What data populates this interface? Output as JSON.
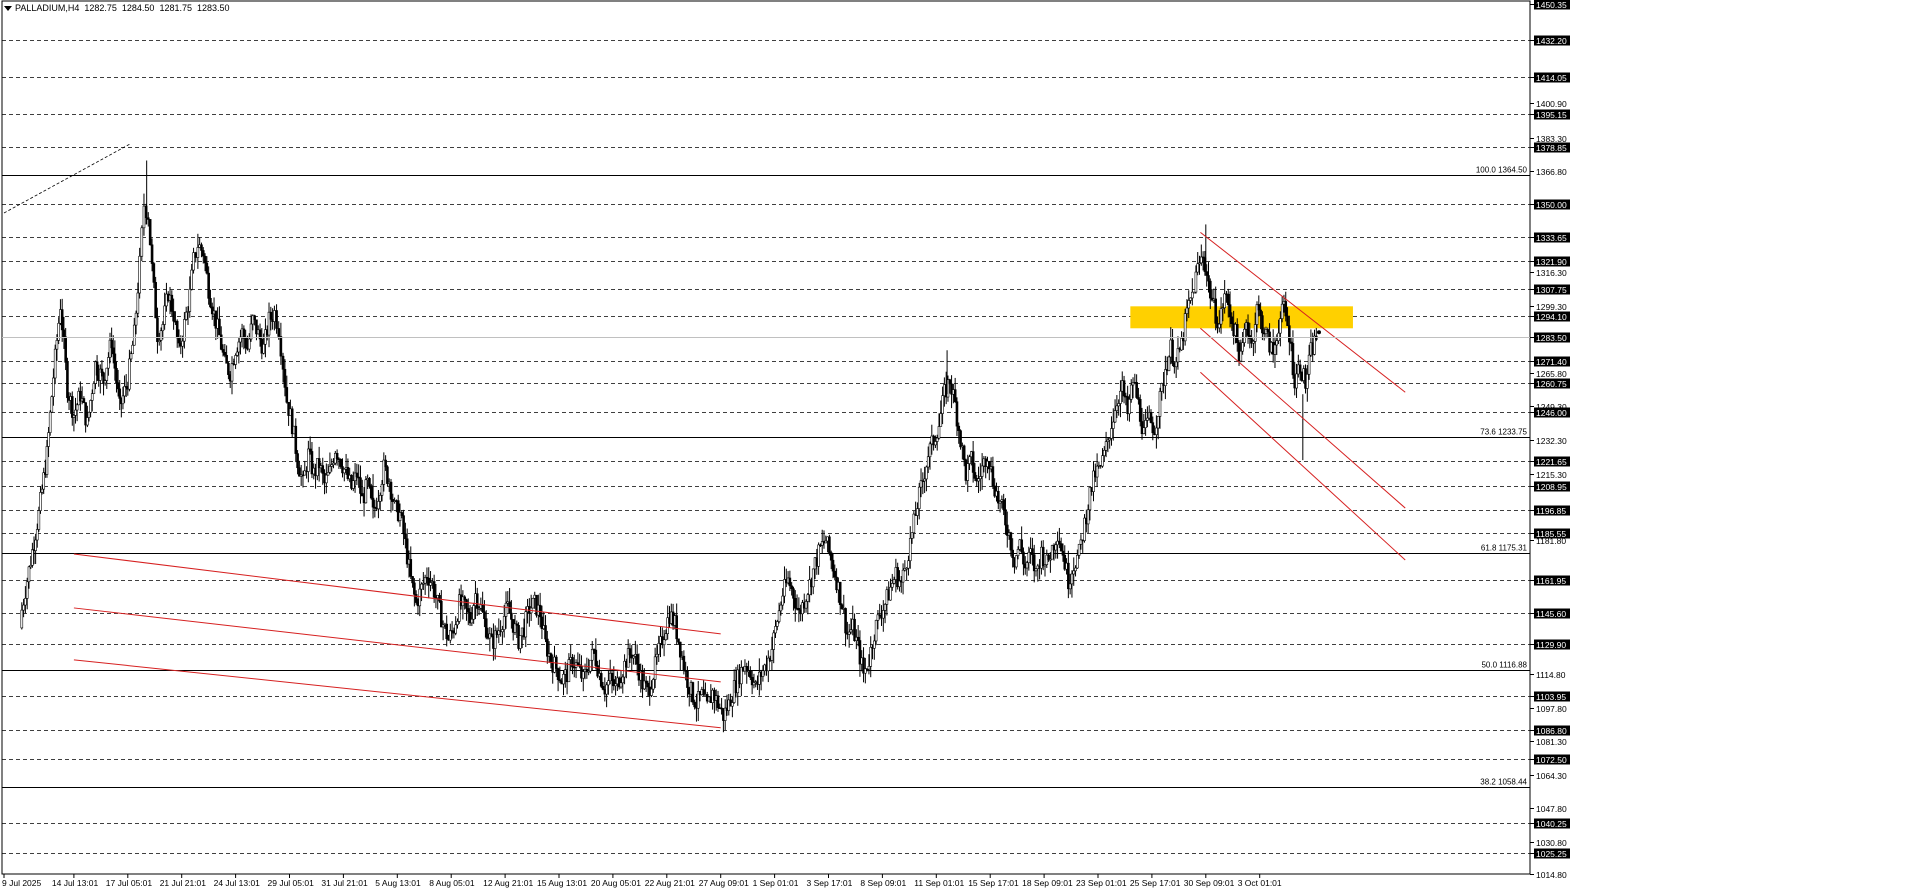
{
  "header": {
    "symbol": "PALLADIUM,H4",
    "open": "1282.75",
    "high": "1284.50",
    "low": "1281.75",
    "close": "1283.50"
  },
  "chart_data": {
    "type": "candlestick",
    "symbol": "PALLADIUM",
    "timeframe": "H4",
    "ylim": [
      1014.8,
      1450.35
    ],
    "price_ticks": [
      "1450.35",
      "1432.20",
      "1414.05",
      "1400.90",
      "1395.15",
      "1383.30",
      "1378.85",
      "1366.80",
      "1350.00",
      "1333.65",
      "1321.90",
      "1316.30",
      "1307.75",
      "1299.30",
      "1294.10",
      "1283.50",
      "1271.40",
      "1265.80",
      "1260.75",
      "1249.30",
      "1246.00",
      "1232.30",
      "1221.65",
      "1215.30",
      "1208.95",
      "1196.85",
      "1185.55",
      "1181.80",
      "1161.95",
      "1145.60",
      "1129.90",
      "1114.80",
      "1103.95",
      "1097.80",
      "1086.80",
      "1081.30",
      "1072.50",
      "1064.30",
      "1047.80",
      "1040.25",
      "1030.80",
      "1025.25",
      "1014.80"
    ],
    "highlighted_ticks": [
      "1450.35",
      "1432.20",
      "1414.05",
      "1395.15",
      "1378.85",
      "1350.00",
      "1333.65",
      "1321.90",
      "1307.75",
      "1294.10",
      "1283.50",
      "1271.40",
      "1260.75",
      "1246.00",
      "1221.65",
      "1208.95",
      "1196.85",
      "1185.55",
      "1161.95",
      "1145.60",
      "1129.90",
      "1103.95",
      "1086.80",
      "1072.50",
      "1040.25",
      "1025.25"
    ],
    "x_labels": [
      "9 Jul 2025",
      "14 Jul 13:01",
      "17 Jul 05:01",
      "21 Jul 21:01",
      "24 Jul 13:01",
      "29 Jul 05:01",
      "31 Jul 21:01",
      "5 Aug 13:01",
      "8 Aug 05:01",
      "12 Aug 21:01",
      "15 Aug 13:01",
      "20 Aug 05:01",
      "22 Aug 21:01",
      "27 Aug 09:01",
      "1 Sep 01:01",
      "3 Sep 17:01",
      "8 Sep 09:01",
      "11 Sep 01:01",
      "15 Sep 17:01",
      "18 Sep 09:01",
      "23 Sep 01:01",
      "25 Sep 17:01",
      "30 Sep 09:01",
      "3 Oct 01:01"
    ],
    "support_resistance_levels": [
      1432.2,
      1414.05,
      1395.15,
      1378.85,
      1350.0,
      1333.65,
      1321.9,
      1307.75,
      1294.1,
      1271.4,
      1260.75,
      1246.0,
      1221.65,
      1208.95,
      1196.85,
      1185.55,
      1161.95,
      1145.6,
      1129.9,
      1103.95,
      1086.8,
      1072.5,
      1040.25,
      1025.25
    ],
    "fibonacci_levels": [
      {
        "label": "100.0 1364.50",
        "value": 1364.5
      },
      {
        "label": "73.6 1233.75",
        "value": 1233.75
      },
      {
        "label": "61.8 1175.31",
        "value": 1175.31
      },
      {
        "label": "50.0 1116.88",
        "value": 1116.88
      },
      {
        "label": "38.2 1058.44",
        "value": 1058.44
      }
    ],
    "zones": [
      {
        "name": "resistance-zone",
        "from": 1288,
        "to": 1299,
        "color": "#ffd000"
      }
    ],
    "trend_channels": [
      {
        "lines": [
          [
            [
              1,
              1175
            ],
            [
              13,
              1135
            ]
          ],
          [
            [
              1,
              1148
            ],
            [
              13,
              1111
            ]
          ],
          [
            [
              1,
              1122
            ],
            [
              13,
              1088
            ]
          ]
        ],
        "color": "#d62020"
      },
      {
        "lines": [
          [
            [
              21.9,
              1336
            ],
            [
              25.7,
              1256
            ]
          ],
          [
            [
              21.9,
              1288
            ],
            [
              25.7,
              1198
            ]
          ],
          [
            [
              21.9,
              1266
            ],
            [
              25.7,
              1172
            ]
          ]
        ],
        "color": "#d62020"
      }
    ],
    "close_path": [
      [
        0,
        1142
      ],
      [
        0.2,
        1172
      ],
      [
        0.35,
        1195
      ],
      [
        0.5,
        1225
      ],
      [
        0.62,
        1264
      ],
      [
        0.75,
        1300
      ],
      [
        0.88,
        1258
      ],
      [
        1.0,
        1245
      ],
      [
        1.12,
        1255
      ],
      [
        1.25,
        1240
      ],
      [
        1.4,
        1270
      ],
      [
        1.55,
        1262
      ],
      [
        1.7,
        1282
      ],
      [
        1.85,
        1248
      ],
      [
        2.0,
        1262
      ],
      [
        2.12,
        1285
      ],
      [
        2.22,
        1320
      ],
      [
        2.3,
        1350
      ],
      [
        2.38,
        1345
      ],
      [
        2.45,
        1318
      ],
      [
        2.55,
        1285
      ],
      [
        2.65,
        1290
      ],
      [
        2.75,
        1306
      ],
      [
        2.85,
        1295
      ],
      [
        2.95,
        1276
      ],
      [
        3.05,
        1290
      ],
      [
        3.15,
        1305
      ],
      [
        3.22,
        1322
      ],
      [
        3.3,
        1330
      ],
      [
        3.4,
        1326
      ],
      [
        3.5,
        1308
      ],
      [
        3.6,
        1295
      ],
      [
        3.7,
        1284
      ],
      [
        3.8,
        1270
      ],
      [
        3.9,
        1266
      ],
      [
        4.0,
        1278
      ],
      [
        4.12,
        1286
      ],
      [
        4.22,
        1278
      ],
      [
        4.32,
        1292
      ],
      [
        4.42,
        1285
      ],
      [
        4.52,
        1278
      ],
      [
        4.62,
        1292
      ],
      [
        4.72,
        1296
      ],
      [
        4.8,
        1288
      ],
      [
        4.88,
        1270
      ],
      [
        4.95,
        1252
      ],
      [
        5.05,
        1240
      ],
      [
        5.15,
        1222
      ],
      [
        5.25,
        1210
      ],
      [
        5.35,
        1225
      ],
      [
        5.45,
        1215
      ],
      [
        5.55,
        1220
      ],
      [
        5.65,
        1210
      ],
      [
        5.75,
        1216
      ],
      [
        5.85,
        1228
      ],
      [
        5.95,
        1222
      ],
      [
        6.05,
        1215
      ],
      [
        6.15,
        1208
      ],
      [
        6.25,
        1215
      ],
      [
        6.35,
        1202
      ],
      [
        6.45,
        1210
      ],
      [
        6.55,
        1195
      ],
      [
        6.65,
        1205
      ],
      [
        6.75,
        1218
      ],
      [
        6.85,
        1212
      ],
      [
        6.95,
        1198
      ],
      [
        7.05,
        1195
      ],
      [
        7.15,
        1180
      ],
      [
        7.25,
        1162
      ],
      [
        7.35,
        1150
      ],
      [
        7.45,
        1158
      ],
      [
        7.55,
        1165
      ],
      [
        7.65,
        1160
      ],
      [
        7.75,
        1150
      ],
      [
        7.85,
        1140
      ],
      [
        7.95,
        1132
      ],
      [
        8.05,
        1138
      ],
      [
        8.15,
        1150
      ],
      [
        8.25,
        1148
      ],
      [
        8.35,
        1142
      ],
      [
        8.45,
        1155
      ],
      [
        8.55,
        1148
      ],
      [
        8.65,
        1138
      ],
      [
        8.75,
        1130
      ],
      [
        8.85,
        1135
      ],
      [
        8.95,
        1142
      ],
      [
        9.05,
        1148
      ],
      [
        9.15,
        1140
      ],
      [
        9.25,
        1132
      ],
      [
        9.35,
        1138
      ],
      [
        9.45,
        1148
      ],
      [
        9.55,
        1150
      ],
      [
        9.65,
        1145
      ],
      [
        9.75,
        1130
      ],
      [
        9.85,
        1122
      ],
      [
        9.95,
        1118
      ],
      [
        10.05,
        1112
      ],
      [
        10.15,
        1115
      ],
      [
        10.25,
        1122
      ],
      [
        10.35,
        1118
      ],
      [
        10.45,
        1112
      ],
      [
        10.55,
        1120
      ],
      [
        10.65,
        1126
      ],
      [
        10.75,
        1115
      ],
      [
        10.85,
        1108
      ],
      [
        10.95,
        1112
      ],
      [
        11.05,
        1108
      ],
      [
        11.15,
        1115
      ],
      [
        11.25,
        1122
      ],
      [
        11.35,
        1126
      ],
      [
        11.45,
        1120
      ],
      [
        11.55,
        1110
      ],
      [
        11.65,
        1106
      ],
      [
        11.75,
        1115
      ],
      [
        11.85,
        1126
      ],
      [
        11.95,
        1136
      ],
      [
        12.05,
        1145
      ],
      [
        12.15,
        1140
      ],
      [
        12.25,
        1128
      ],
      [
        12.35,
        1115
      ],
      [
        12.45,
        1106
      ],
      [
        12.55,
        1100
      ],
      [
        12.65,
        1104
      ],
      [
        12.75,
        1098
      ],
      [
        12.85,
        1106
      ],
      [
        12.95,
        1100
      ],
      [
        13.05,
        1094
      ],
      [
        13.15,
        1100
      ],
      [
        13.25,
        1108
      ],
      [
        13.35,
        1115
      ],
      [
        13.45,
        1120
      ],
      [
        13.55,
        1116
      ],
      [
        13.65,
        1108
      ],
      [
        13.75,
        1115
      ],
      [
        13.85,
        1120
      ],
      [
        13.95,
        1128
      ],
      [
        14.05,
        1142
      ],
      [
        14.15,
        1155
      ],
      [
        14.25,
        1162
      ],
      [
        14.35,
        1155
      ],
      [
        14.45,
        1145
      ],
      [
        14.55,
        1152
      ],
      [
        14.65,
        1160
      ],
      [
        14.75,
        1170
      ],
      [
        14.85,
        1178
      ],
      [
        14.95,
        1182
      ],
      [
        15.05,
        1172
      ],
      [
        15.15,
        1162
      ],
      [
        15.25,
        1150
      ],
      [
        15.35,
        1135
      ],
      [
        15.45,
        1138
      ],
      [
        15.55,
        1128
      ],
      [
        15.65,
        1115
      ],
      [
        15.75,
        1122
      ],
      [
        15.85,
        1136
      ],
      [
        15.95,
        1145
      ],
      [
        16.05,
        1150
      ],
      [
        16.15,
        1158
      ],
      [
        16.25,
        1165
      ],
      [
        16.35,
        1160
      ],
      [
        16.45,
        1172
      ],
      [
        16.55,
        1185
      ],
      [
        16.65,
        1200
      ],
      [
        16.75,
        1212
      ],
      [
        16.85,
        1225
      ],
      [
        16.95,
        1232
      ],
      [
        17.05,
        1240
      ],
      [
        17.15,
        1255
      ],
      [
        17.25,
        1262
      ],
      [
        17.35,
        1250
      ],
      [
        17.45,
        1232
      ],
      [
        17.55,
        1215
      ],
      [
        17.65,
        1222
      ],
      [
        17.75,
        1210
      ],
      [
        17.85,
        1218
      ],
      [
        17.95,
        1226
      ],
      [
        18.05,
        1212
      ],
      [
        18.15,
        1202
      ],
      [
        18.25,
        1195
      ],
      [
        18.35,
        1185
      ],
      [
        18.45,
        1172
      ],
      [
        18.55,
        1180
      ],
      [
        18.65,
        1168
      ],
      [
        18.75,
        1175
      ],
      [
        18.85,
        1165
      ],
      [
        18.95,
        1176
      ],
      [
        19.05,
        1170
      ],
      [
        19.15,
        1178
      ],
      [
        19.25,
        1186
      ],
      [
        19.35,
        1175
      ],
      [
        19.45,
        1162
      ],
      [
        19.55,
        1170
      ],
      [
        19.65,
        1175
      ],
      [
        19.75,
        1190
      ],
      [
        19.85,
        1205
      ],
      [
        19.95,
        1215
      ],
      [
        20.05,
        1218
      ],
      [
        20.15,
        1228
      ],
      [
        20.25,
        1240
      ],
      [
        20.35,
        1252
      ],
      [
        20.45,
        1258
      ],
      [
        20.55,
        1245
      ],
      [
        20.65,
        1262
      ],
      [
        20.75,
        1250
      ],
      [
        20.85,
        1235
      ],
      [
        20.95,
        1242
      ],
      [
        21.05,
        1238
      ],
      [
        21.15,
        1252
      ],
      [
        21.25,
        1268
      ],
      [
        21.35,
        1278
      ],
      [
        21.45,
        1270
      ],
      [
        21.55,
        1280
      ],
      [
        21.65,
        1296
      ],
      [
        21.75,
        1305
      ],
      [
        21.85,
        1318
      ],
      [
        21.95,
        1325
      ],
      [
        22.05,
        1310
      ],
      [
        22.15,
        1298
      ],
      [
        22.25,
        1290
      ],
      [
        22.35,
        1305
      ],
      [
        22.45,
        1296
      ],
      [
        22.55,
        1285
      ],
      [
        22.65,
        1272
      ],
      [
        22.75,
        1292
      ],
      [
        22.85,
        1280
      ],
      [
        22.95,
        1298
      ],
      [
        23.05,
        1290
      ],
      [
        23.15,
        1282
      ],
      [
        23.25,
        1275
      ],
      [
        23.35,
        1290
      ],
      [
        23.45,
        1298
      ],
      [
        23.55,
        1285
      ],
      [
        23.65,
        1262
      ],
      [
        23.75,
        1270
      ],
      [
        23.85,
        1260
      ],
      [
        23.95,
        1276
      ],
      [
        24.05,
        1283.5
      ]
    ],
    "price_line": 1283.5
  },
  "colors": {
    "candle": "#000000",
    "grid": "#000000",
    "channel": "#d62020",
    "zone": "#ffd000",
    "price_line": "#c0c0c0"
  }
}
